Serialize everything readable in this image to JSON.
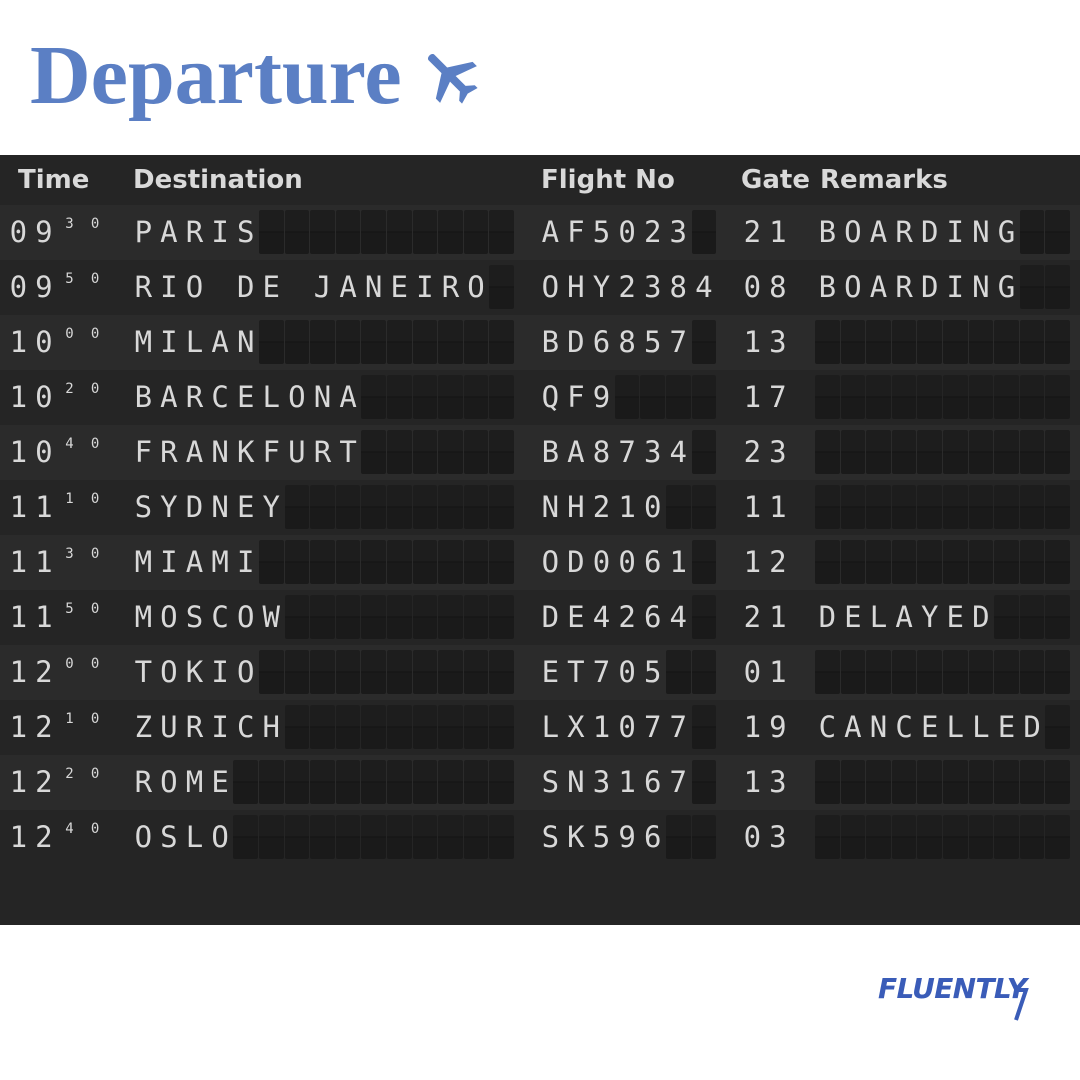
{
  "title": "Departure",
  "title_icon": "airplane-icon",
  "columns": {
    "time": "Time",
    "destination": "Destination",
    "flight": "Flight No",
    "gate": "Gate",
    "remarks": "Remarks"
  },
  "flights": [
    {
      "time": "0930",
      "destination": "PARIS",
      "flight": "AF5023",
      "gate": "21",
      "remarks": "BOARDING"
    },
    {
      "time": "0950",
      "destination": "RIO DE JANEIRO",
      "flight": "OHY2384",
      "gate": "08",
      "remarks": "BOARDING"
    },
    {
      "time": "1000",
      "destination": "MILAN",
      "flight": "BD6857",
      "gate": "13",
      "remarks": ""
    },
    {
      "time": "1020",
      "destination": "BARCELONA",
      "flight": "QF9",
      "gate": "17",
      "remarks": ""
    },
    {
      "time": "1040",
      "destination": "FRANKFURT",
      "flight": "BA8734",
      "gate": "23",
      "remarks": ""
    },
    {
      "time": "1110",
      "destination": "SYDNEY",
      "flight": "NH210",
      "gate": "11",
      "remarks": ""
    },
    {
      "time": "1130",
      "destination": "MIAMI",
      "flight": "OD0061",
      "gate": "12",
      "remarks": ""
    },
    {
      "time": "1150",
      "destination": "MOSCOW",
      "flight": "DE4264",
      "gate": "21",
      "remarks": "DELAYED"
    },
    {
      "time": "1200",
      "destination": "TOKIO",
      "flight": "ET705",
      "gate": "01",
      "remarks": ""
    },
    {
      "time": "1210",
      "destination": "ZURICH",
      "flight": "LX1077",
      "gate": "19",
      "remarks": "CANCELLED"
    },
    {
      "time": "1220",
      "destination": "ROME",
      "flight": "SN3167",
      "gate": "13",
      "remarks": ""
    },
    {
      "time": "1240",
      "destination": "OSLO",
      "flight": "SK596",
      "gate": "03",
      "remarks": ""
    }
  ],
  "brand": "FLUENTLY",
  "colors": {
    "title": "#5b7fc4",
    "board": "#252525",
    "text": "#d8d8d8",
    "brand": "#3a5cb8"
  }
}
